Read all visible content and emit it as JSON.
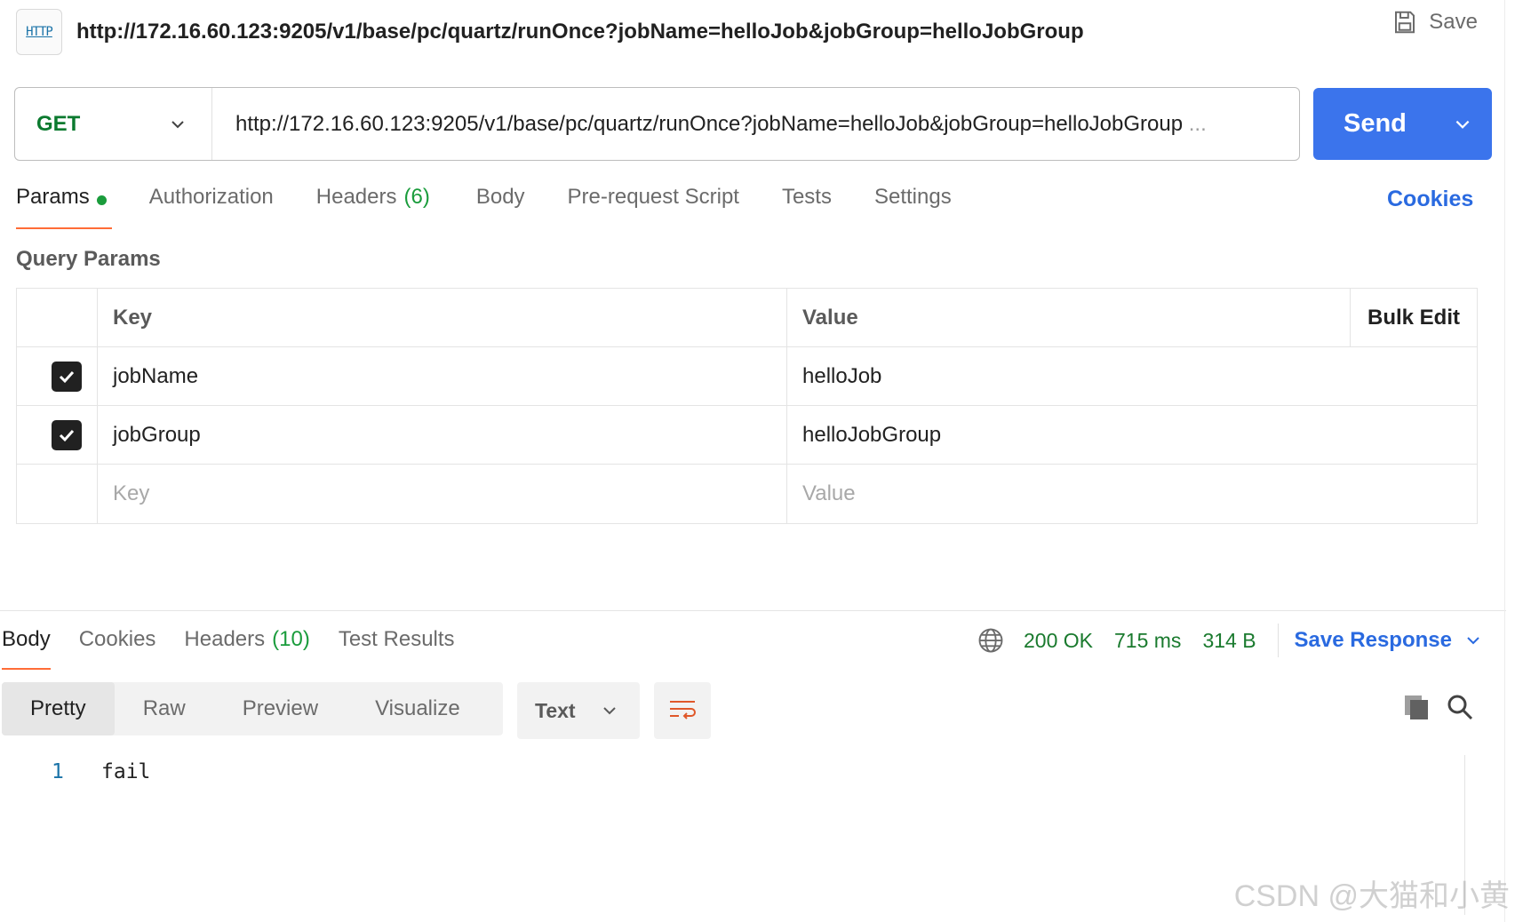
{
  "title_bar": {
    "icon_text": "HTTP",
    "title": "http://172.16.60.123:9205/v1/base/pc/quartz/runOnce?jobName=helloJob&jobGroup=helloJobGroup",
    "save_label": "Save"
  },
  "request": {
    "method": "GET",
    "url": "http://172.16.60.123:9205/v1/base/pc/quartz/runOnce?jobName=helloJob&jobGroup=helloJobGroup",
    "url_overflow": "...",
    "send_label": "Send"
  },
  "request_tabs": {
    "params": "Params",
    "authorization": "Authorization",
    "headers": "Headers",
    "headers_count": "(6)",
    "body": "Body",
    "pre_request": "Pre-request Script",
    "tests": "Tests",
    "settings": "Settings",
    "cookies": "Cookies"
  },
  "query_params": {
    "title": "Query Params",
    "col_key": "Key",
    "col_value": "Value",
    "bulk_edit": "Bulk Edit",
    "rows": [
      {
        "key": "jobName",
        "value": "helloJob",
        "checked": true
      },
      {
        "key": "jobGroup",
        "value": "helloJobGroup",
        "checked": true
      }
    ],
    "key_placeholder": "Key",
    "value_placeholder": "Value"
  },
  "response_tabs": {
    "body": "Body",
    "cookies": "Cookies",
    "headers": "Headers",
    "headers_count": "(10)",
    "test_results": "Test Results"
  },
  "response_status": {
    "status": "200 OK",
    "time": "715 ms",
    "size": "314 B",
    "save_response": "Save Response"
  },
  "view_tabs": {
    "pretty": "Pretty",
    "raw": "Raw",
    "preview": "Preview",
    "visualize": "Visualize",
    "format": "Text"
  },
  "response_body": {
    "line_number": "1",
    "content": "fail"
  },
  "watermark": "CSDN @大猫和小黄",
  "colors": {
    "send": "#3b74ec",
    "method": "#0b7a2f",
    "active_tab_underline": "#ff6c37",
    "link": "#2a6ae0",
    "status": "#1a7a2e"
  }
}
